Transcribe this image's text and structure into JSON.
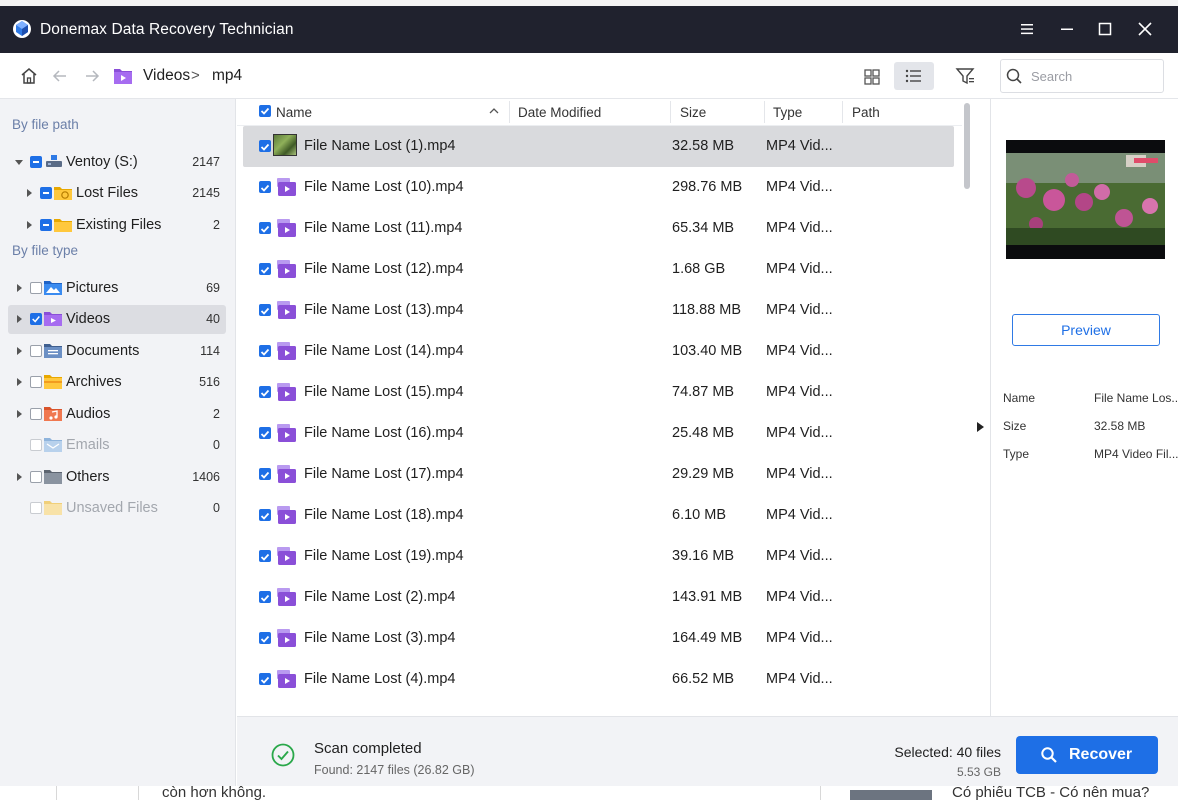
{
  "window": {
    "title": "Donemax Data Recovery  Technician"
  },
  "breadcrumb": {
    "folder": "Videos",
    "separator": ">",
    "current": "mp4"
  },
  "search": {
    "placeholder": "Search"
  },
  "sidebar": {
    "heading_path": "By file path",
    "heading_type": "By file type",
    "path_items": [
      {
        "label": "Ventoy (S:)",
        "count": "2147"
      },
      {
        "label": "Lost Files",
        "count": "2145"
      },
      {
        "label": "Existing Files",
        "count": "2"
      }
    ],
    "type_items": [
      {
        "label": "Pictures",
        "count": "69"
      },
      {
        "label": "Videos",
        "count": "40"
      },
      {
        "label": "Documents",
        "count": "114"
      },
      {
        "label": "Archives",
        "count": "516"
      },
      {
        "label": "Audios",
        "count": "2"
      },
      {
        "label": "Emails",
        "count": "0"
      },
      {
        "label": "Others",
        "count": "1406"
      },
      {
        "label": "Unsaved Files",
        "count": "0"
      }
    ]
  },
  "list": {
    "columns": [
      "Name",
      "Date Modified",
      "Size",
      "Type",
      "Path"
    ],
    "rows": [
      {
        "name": "File Name Lost (1).mp4",
        "size": "32.58 MB",
        "type": "MP4 Vid..."
      },
      {
        "name": "File Name Lost (10).mp4",
        "size": "298.76 MB",
        "type": "MP4 Vid..."
      },
      {
        "name": "File Name Lost (11).mp4",
        "size": "65.34 MB",
        "type": "MP4 Vid..."
      },
      {
        "name": "File Name Lost (12).mp4",
        "size": "1.68 GB",
        "type": "MP4 Vid..."
      },
      {
        "name": "File Name Lost (13).mp4",
        "size": "118.88 MB",
        "type": "MP4 Vid..."
      },
      {
        "name": "File Name Lost (14).mp4",
        "size": "103.40 MB",
        "type": "MP4 Vid..."
      },
      {
        "name": "File Name Lost (15).mp4",
        "size": "74.87 MB",
        "type": "MP4 Vid..."
      },
      {
        "name": "File Name Lost (16).mp4",
        "size": "25.48 MB",
        "type": "MP4 Vid..."
      },
      {
        "name": "File Name Lost (17).mp4",
        "size": "29.29 MB",
        "type": "MP4 Vid..."
      },
      {
        "name": "File Name Lost (18).mp4",
        "size": "6.10 MB",
        "type": "MP4 Vid..."
      },
      {
        "name": "File Name Lost (19).mp4",
        "size": "39.16 MB",
        "type": "MP4 Vid..."
      },
      {
        "name": "File Name Lost (2).mp4",
        "size": "143.91 MB",
        "type": "MP4 Vid..."
      },
      {
        "name": "File Name Lost (3).mp4",
        "size": "164.49 MB",
        "type": "MP4 Vid..."
      },
      {
        "name": "File Name Lost (4).mp4",
        "size": "66.52 MB",
        "type": "MP4 Vid..."
      }
    ]
  },
  "preview": {
    "button": "Preview",
    "details": [
      {
        "key": "Name",
        "value": "File Name Los..."
      },
      {
        "key": "Size",
        "value": "32.58 MB"
      },
      {
        "key": "Type",
        "value": "MP4 Video Fil..."
      }
    ]
  },
  "status": {
    "title": "Scan completed",
    "found": "Found: 2147 files (26.82 GB)",
    "selected": "Selected: 40 files",
    "selected_size": "5.53 GB",
    "recover_label": "Recover"
  },
  "background": {
    "left_text": "còn hơn không.",
    "right_text": "Có phiếu TCB - Có nên mua?"
  },
  "colors": {
    "accent": "#1e6fe6",
    "titlebar": "#20222e",
    "sidebar_bg": "#f2f3f6",
    "success": "#2aa84a"
  }
}
